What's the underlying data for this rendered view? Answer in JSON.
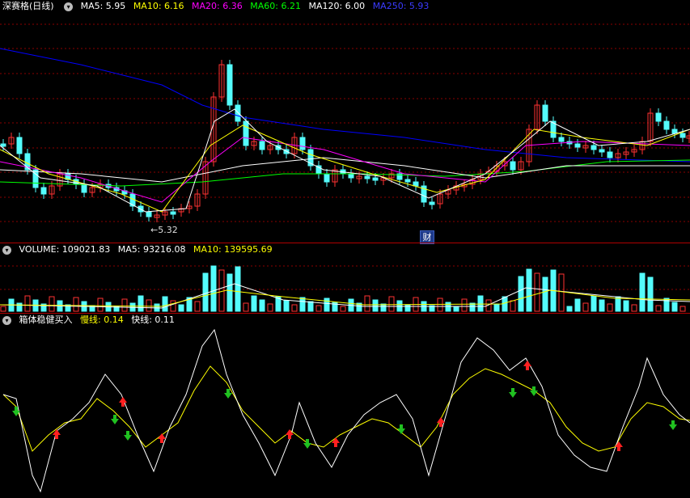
{
  "main": {
    "title": "深赛格(日线)",
    "indicators": [
      {
        "label": "MA5: 5.95",
        "color": "#ffffff"
      },
      {
        "label": "MA10: 6.16",
        "color": "#ffff00"
      },
      {
        "label": "MA20: 6.36",
        "color": "#ff00ff"
      },
      {
        "label": "MA60: 6.21",
        "color": "#00ff00"
      },
      {
        "label": "MA120: 6.00",
        "color": "#ffffff"
      },
      {
        "label": "MA250: 5.93",
        "color": "#0000ff"
      }
    ],
    "low_marker": "5.32",
    "event_badge": "财"
  },
  "volume": {
    "label": "VOLUME: 109021.83",
    "ma5": "MA5: 93216.08",
    "ma10": "MA10: 139595.69"
  },
  "indicator": {
    "name": "箱体稳健买入",
    "slow": "慢线: 0.14",
    "fast": "快线: 0.11"
  },
  "colors": {
    "up": "#ff3232",
    "down": "#54fcfc",
    "grid": "#8b0000",
    "background": "#000000"
  }
}
